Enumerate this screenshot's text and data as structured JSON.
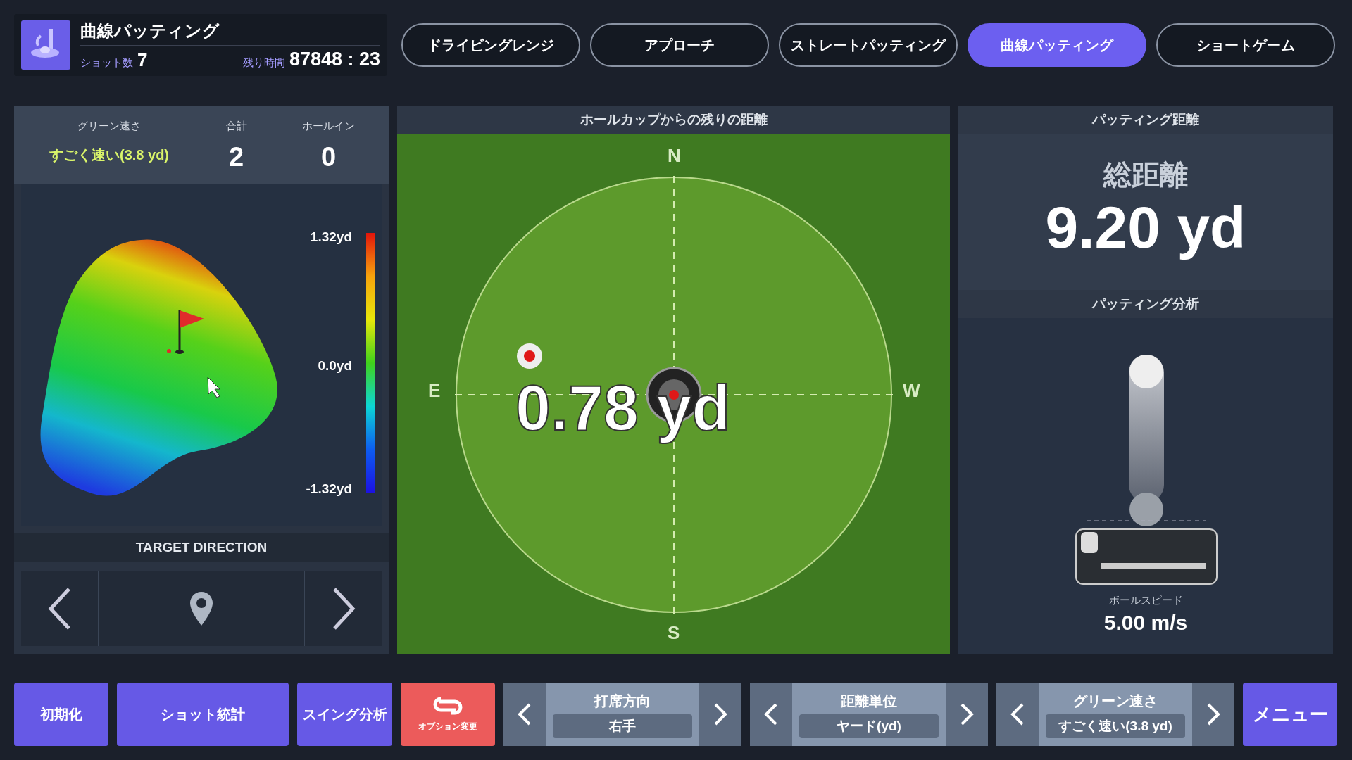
{
  "header": {
    "title": "曲線パッティング",
    "shots_label": "ショット数",
    "shots": "7",
    "time_label": "残り時間",
    "time": "87848 : 23"
  },
  "tabs": [
    {
      "label": "ドライビングレンジ",
      "selected": false
    },
    {
      "label": "アプローチ",
      "selected": false
    },
    {
      "label": "ストレートパッティング",
      "selected": false
    },
    {
      "label": "曲線パッティング",
      "selected": true
    },
    {
      "label": "ショートゲーム",
      "selected": false
    }
  ],
  "stats": [
    {
      "label": "グリーン速さ",
      "value": "すごく速い(3.8 yd)",
      "kind": "speed"
    },
    {
      "label": "合計",
      "value": "2",
      "kind": "count"
    },
    {
      "label": "ホールイン",
      "value": "0",
      "kind": "count"
    }
  ],
  "slope_map": {
    "scale_labels": [
      "1.32yd",
      "0.0yd",
      "-1.32yd"
    ]
  },
  "target_direction": {
    "title": "TARGET DIRECTION"
  },
  "green": {
    "title": "ホールカップからの残りの距離",
    "north": "N",
    "east": "E",
    "west": "W",
    "south": "S",
    "distance": "0.78 yd"
  },
  "putting_distance": {
    "title": "パッティング距離",
    "total_label": "総距離",
    "total": "9.20 yd"
  },
  "analysis": {
    "title": "パッティング分析",
    "ball_speed_label": "ボールスピード",
    "ball_speed": "5.00 m/s"
  },
  "bottom_buttons": [
    "初期化",
    "ショット統計",
    "スイング分析"
  ],
  "option_button": {
    "label": "オプション変更"
  },
  "selectors": [
    {
      "title": "打席方向",
      "value": "右手"
    },
    {
      "title": "距離単位",
      "value": "ヤード(yd)"
    },
    {
      "title": "グリーン速さ",
      "value": "すごく速い(3.8 yd)"
    }
  ],
  "menu_button": "メニュー"
}
